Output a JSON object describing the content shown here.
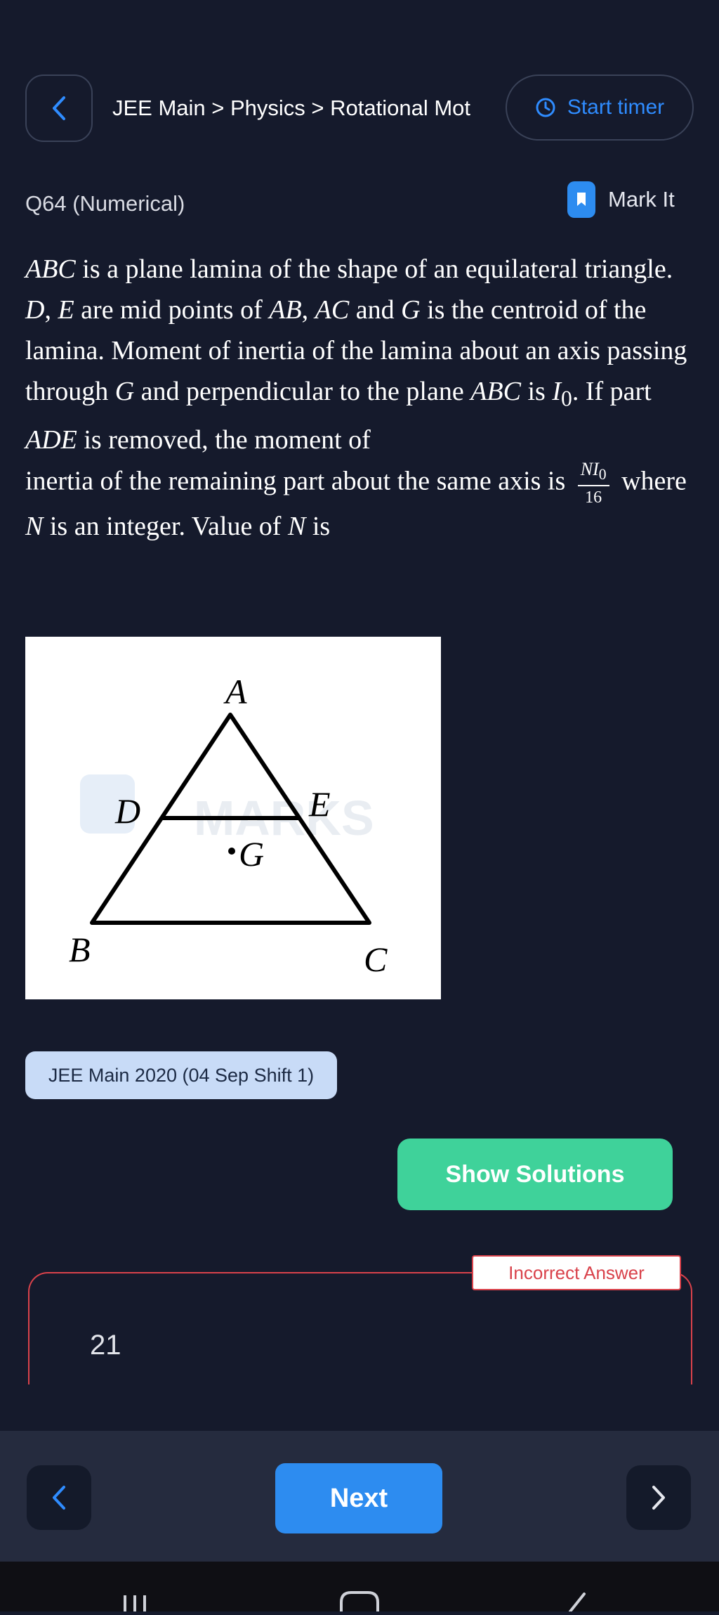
{
  "header": {
    "back_icon": "chevron-left-icon",
    "breadcrumb": "JEE Main > Physics > Rotational Mot",
    "timer_icon": "clock-icon",
    "timer_label": "Start timer"
  },
  "question": {
    "number_label": "Q64 (Numerical)",
    "mark_icon": "bookmark-icon",
    "mark_label": "Mark It"
  },
  "figure": {
    "labels": {
      "A": "A",
      "B": "B",
      "C": "C",
      "D": "D",
      "E": "E",
      "G": "G"
    },
    "watermark": "MARKS"
  },
  "exam_tag": "JEE Main 2020 (04 Sep Shift 1)",
  "show_solutions_label": "Show Solutions",
  "answer": {
    "status": "Incorrect Answer",
    "value": "21"
  },
  "navigation": {
    "prev_icon": "chevron-left-icon",
    "next_label": "Next",
    "next_icon": "chevron-right-icon"
  },
  "colors": {
    "background": "#151a2c",
    "accent": "#2f8cff",
    "success": "#3fd29a",
    "error": "#d9424b",
    "tag_bg": "#c8dbf7"
  }
}
